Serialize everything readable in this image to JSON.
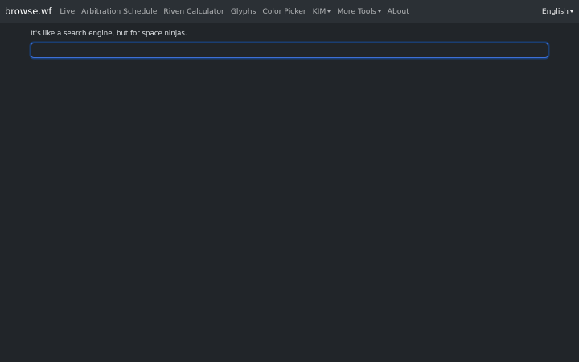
{
  "navbar": {
    "brand": "browse.wf",
    "links": [
      {
        "label": "Live"
      },
      {
        "label": "Arbitration Schedule"
      },
      {
        "label": "Riven Calculator"
      },
      {
        "label": "Glyphs"
      },
      {
        "label": "Color Picker"
      },
      {
        "label": "KIM",
        "dropdown": true
      },
      {
        "label": "More Tools",
        "dropdown": true
      },
      {
        "label": "About"
      }
    ],
    "language": "English"
  },
  "main": {
    "tagline": "It's like a search engine, but for space ninjas.",
    "search": {
      "value": "",
      "placeholder": ""
    }
  },
  "colors": {
    "background": "#212529",
    "navbar": "#2b3035",
    "focus_border": "#3d6fd6"
  }
}
